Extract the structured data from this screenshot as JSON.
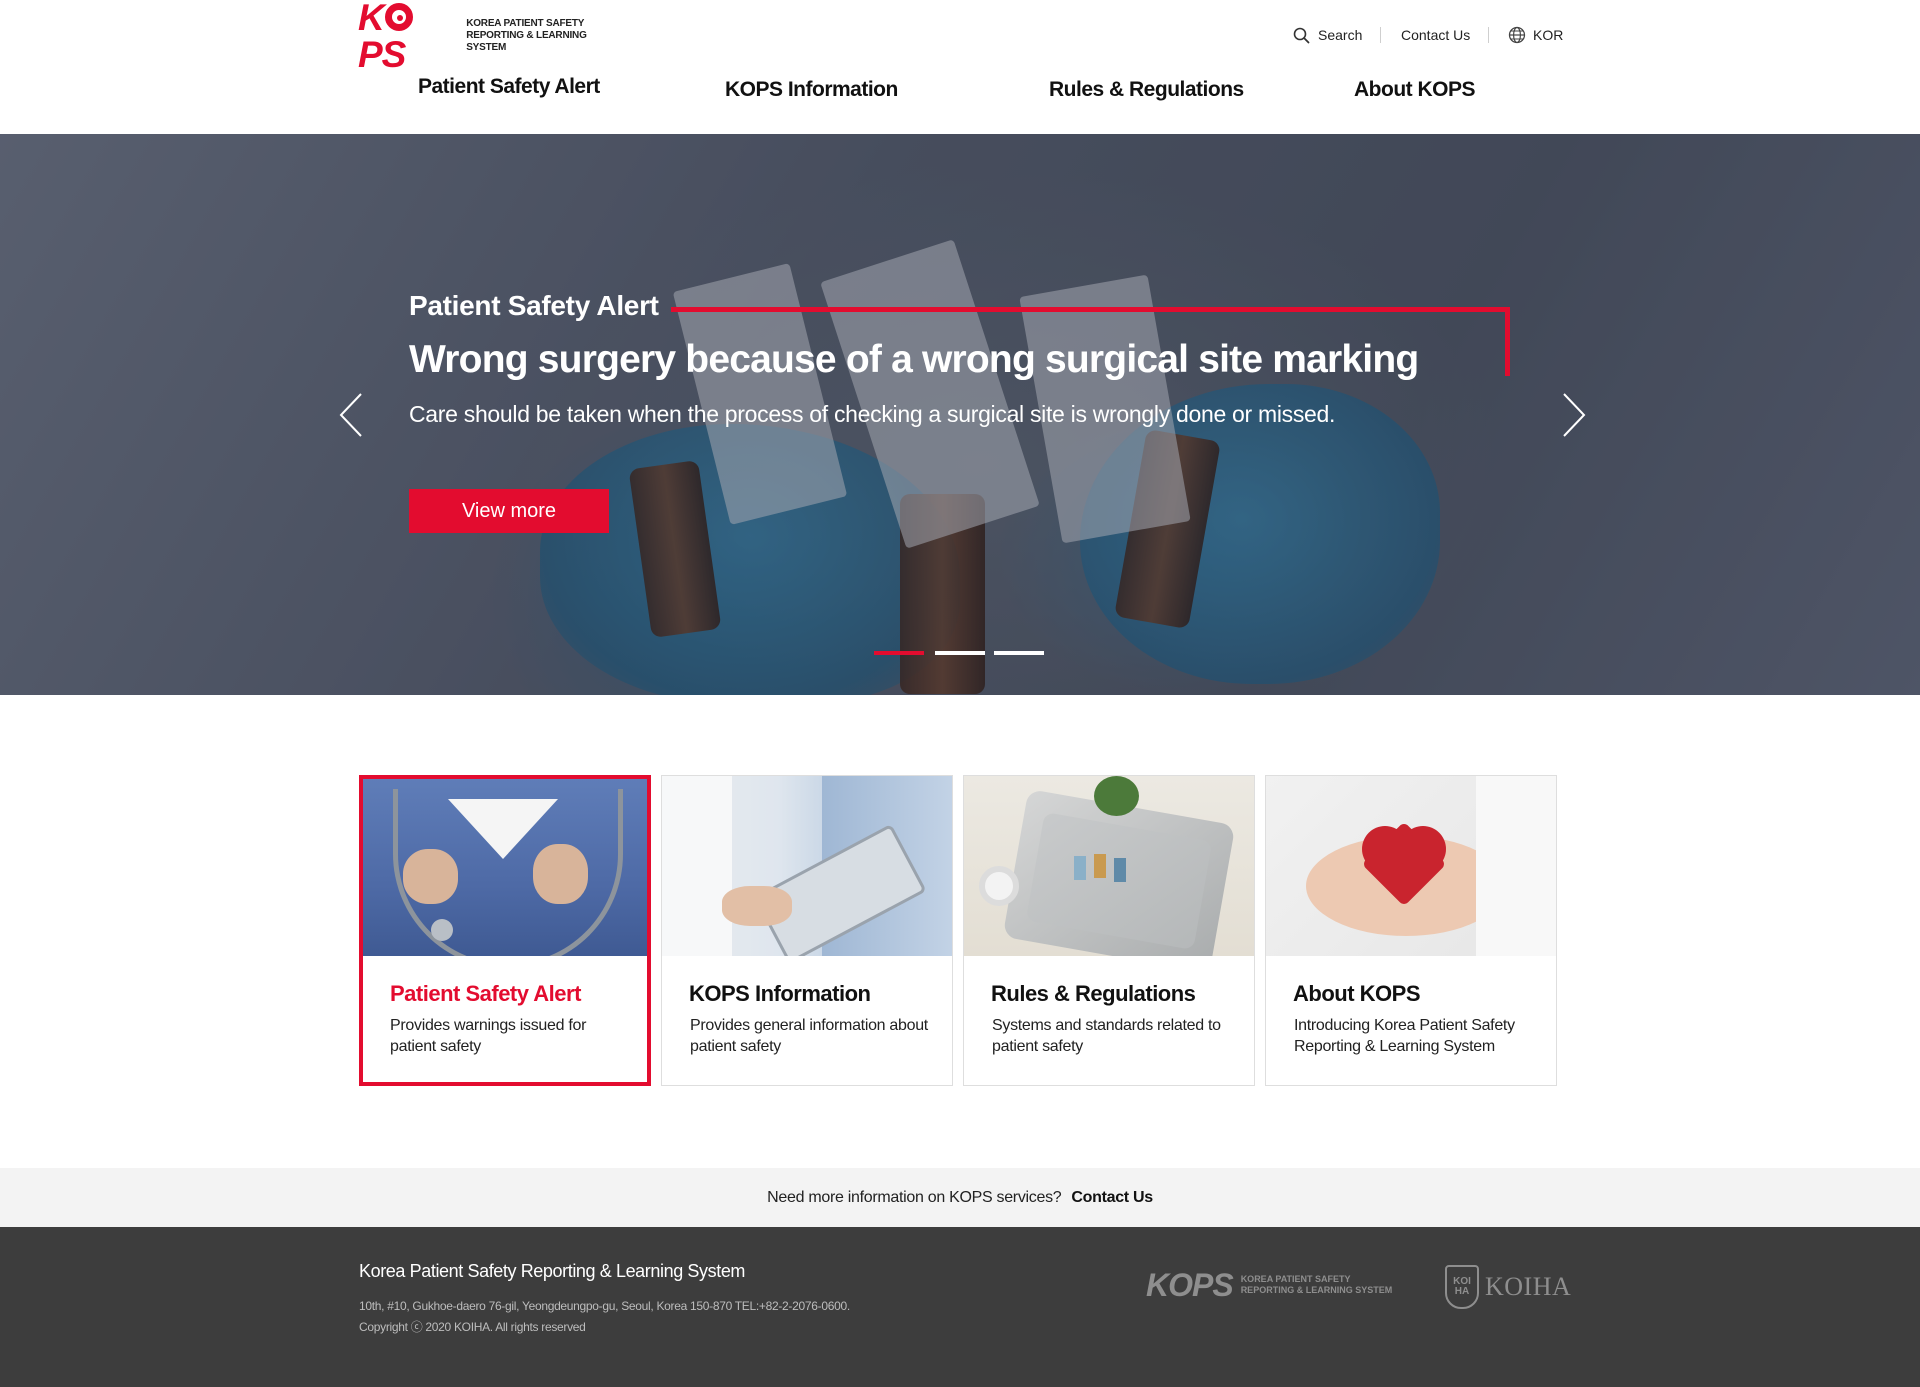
{
  "header": {
    "logo_text": "KOPS",
    "logo_sub_line1": "KOREA PATIENT SAFETY",
    "logo_sub_line2": "REPORTING & LEARNING SYSTEM",
    "util": {
      "search": "Search",
      "contact": "Contact Us",
      "language": "KOR"
    },
    "nav": [
      "Patient Safety Alert",
      "KOPS Information",
      "Rules & Regulations",
      "About KOPS"
    ]
  },
  "hero": {
    "eyebrow": "Patient Safety Alert",
    "title": "Wrong surgery because of a wrong surgical site marking",
    "description": "Care should be taken when the process of checking a surgical site is wrongly done or missed.",
    "button": "View more",
    "slide_count": 3,
    "active_slide": 1
  },
  "cards": [
    {
      "title": "Patient Safety Alert",
      "desc": "Provides warnings issued for patient safety",
      "active": true
    },
    {
      "title": "KOPS Information",
      "desc": "Provides general information about patient safety",
      "active": false
    },
    {
      "title": "Rules & Regulations",
      "desc": "Systems and standards related to patient safety",
      "active": false
    },
    {
      "title": "About KOPS",
      "desc": "Introducing Korea Patient Safety Reporting & Learning System",
      "active": false
    }
  ],
  "contact_strip": {
    "text": "Need more information on KOPS services?",
    "link": "Contact Us"
  },
  "footer": {
    "title": "Korea Patient Safety Reporting & Learning System",
    "address": "10th, #10, Gukhoe-daero 76-gil, Yeongdeungpo-gu, Seoul, Korea 150-870 TEL:+82-2-2076-0600.",
    "copyright": "Copyright ⓒ 2020 KOIHA. All rights reserved",
    "logo_text": "KOPS",
    "logo_sub_line1": "KOREA PATIENT SAFETY",
    "logo_sub_line2": "REPORTING & LEARNING SYSTEM",
    "partner_logo": "KOIHA",
    "partner_badge": "KOI HA"
  },
  "colors": {
    "brand_red": "#e30c2f",
    "footer_bg": "#3d3d3d",
    "strip_bg": "#f3f3f3"
  },
  "icons": [
    "search-icon",
    "globe-icon",
    "chevron-left-icon",
    "chevron-right-icon"
  ]
}
